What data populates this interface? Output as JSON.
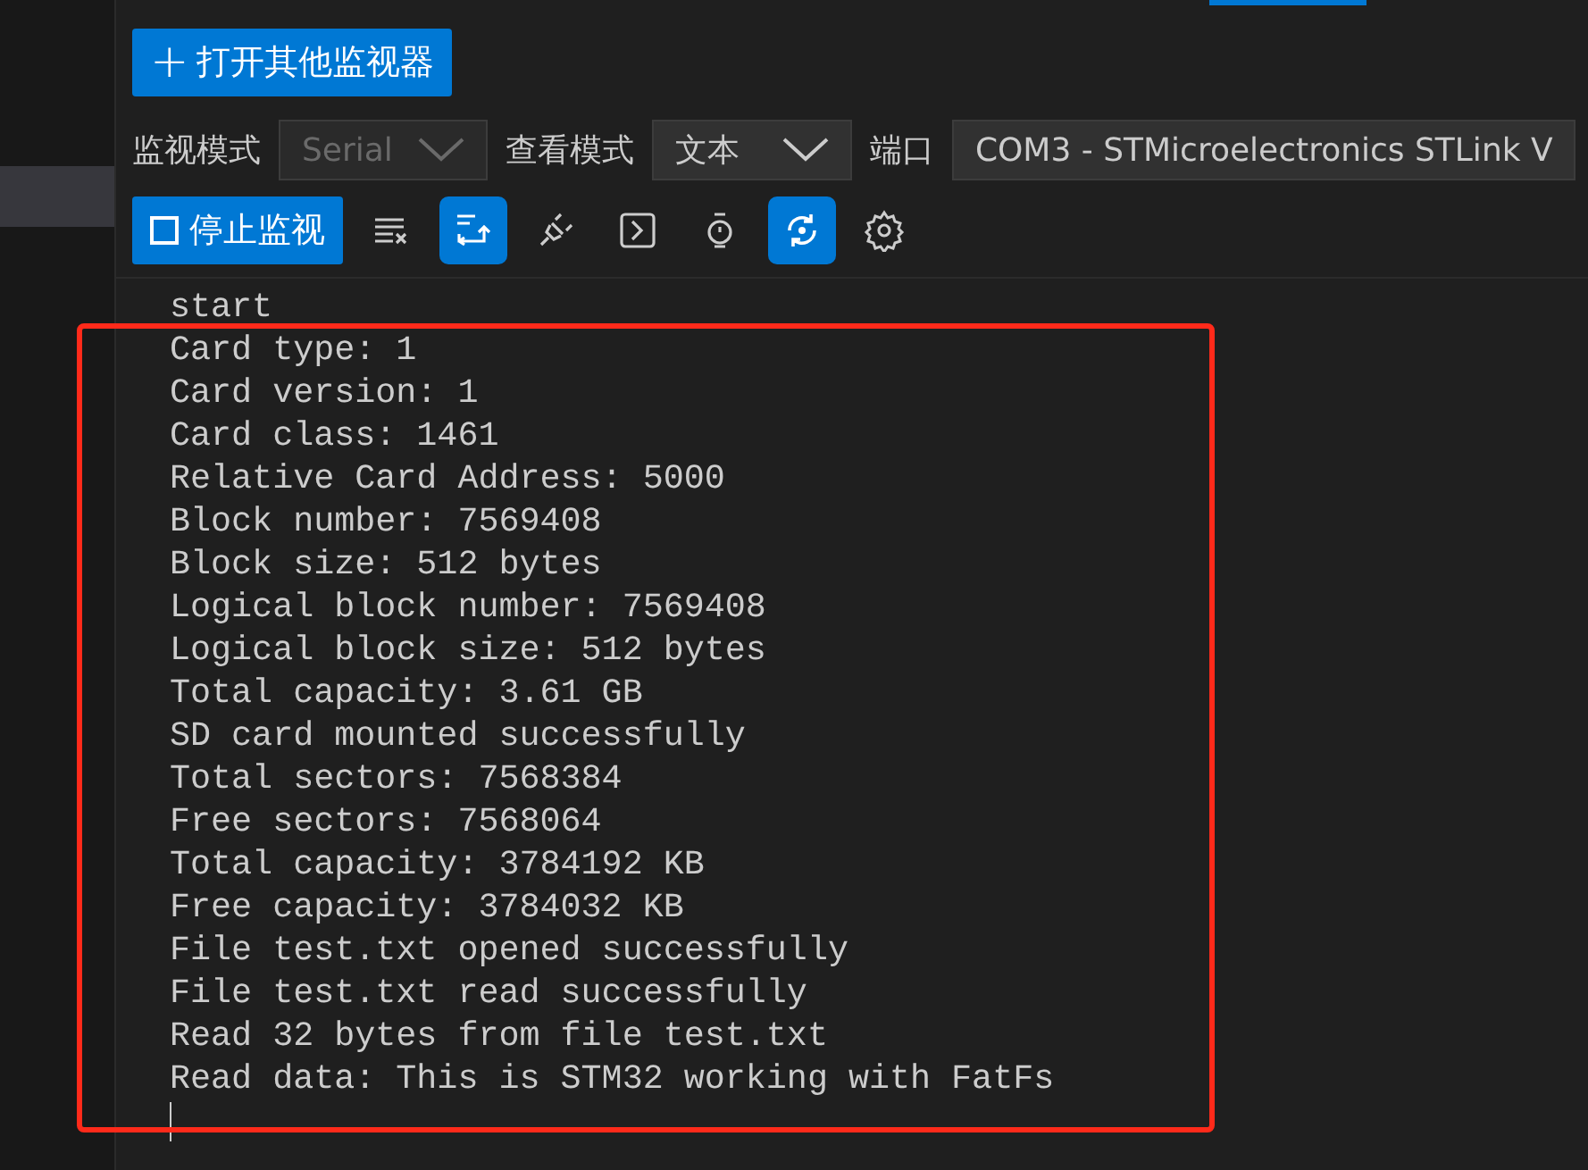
{
  "sidebar": {
    "items": [
      {
        "selected": true
      }
    ]
  },
  "open_button": {
    "icon": "+",
    "label": "打开其他监视器"
  },
  "settings": [
    {
      "label": "监视模式",
      "value": "Serial",
      "disabled": true
    },
    {
      "label": "查看模式",
      "value": "文本",
      "disabled": false
    },
    {
      "label": "端口",
      "value": "COM3 - STMicroelectronics STLink V",
      "disabled": false
    }
  ],
  "stop_button": {
    "label": "停止监视"
  },
  "toolbar": [
    {
      "kind": "clear",
      "on": false
    },
    {
      "kind": "wrap",
      "on": true
    },
    {
      "kind": "plug",
      "on": false
    },
    {
      "kind": "terminal",
      "on": false
    },
    {
      "kind": "timestamp",
      "on": false
    },
    {
      "kind": "autoscroll",
      "on": true
    },
    {
      "kind": "settings",
      "on": false
    }
  ],
  "output": {
    "lines": [
      "start",
      "Card type: 1",
      "Card version: 1",
      "Card class: 1461",
      "Relative Card Address: 5000",
      "Block number: 7569408",
      "Block size: 512 bytes",
      "Logical block number: 7569408",
      "Logical block size: 512 bytes",
      "Total capacity: 3.61 GB",
      "SD card mounted successfully",
      "Total sectors: 7568384",
      "Free sectors: 7568064",
      "Total capacity: 3784192 KB",
      "Free capacity: 3784032 KB",
      "File test.txt opened successfully",
      "File test.txt read successfully",
      "Read 32 bytes from file test.txt",
      "Read data: This is STM32 working with FatFs"
    ],
    "cursor": true,
    "highlight": true
  }
}
